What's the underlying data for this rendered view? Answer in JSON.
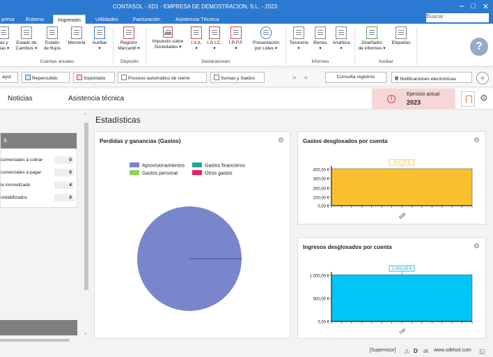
{
  "window": {
    "title": "CONTASOL - XD1 - EMPRESA DE DEMOSTRACION, S.L. - 2023",
    "search_label": "Buscar"
  },
  "menu": {
    "tabs": [
      {
        "label": "presa",
        "active": false
      },
      {
        "label": "Entorno",
        "active": false
      },
      {
        "label": "Impresión",
        "active": true
      },
      {
        "label": "Utilidades",
        "active": false
      },
      {
        "label": "Facturación",
        "active": false
      },
      {
        "label": "Asistencia Técnica",
        "active": false
      }
    ]
  },
  "ribbon": {
    "buttons": [
      {
        "label1": "ias y",
        "label2": "cias ▾",
        "icon": "document-icon"
      },
      {
        "label1": "Estado de",
        "label2": "Cambios ▾",
        "icon": "document-icon"
      },
      {
        "label1": "Estado",
        "label2": "de flujos",
        "icon": "document-icon"
      },
      {
        "label1": "Memoria",
        "label2": "",
        "icon": "document-icon"
      },
      {
        "label1": "Auxiliar",
        "label2": "▾",
        "icon": "list-icon"
      },
      {
        "label1": "Registro",
        "label2": "Mercantil ▾",
        "icon": "document-icon"
      },
      {
        "label1": "Impuesto sobre",
        "label2": "Sociedades ▾",
        "icon": "form-200-icon",
        "badge": "200"
      },
      {
        "label1": "I.V.A.",
        "label2": "▾",
        "icon": "form-icon"
      },
      {
        "label1": "I.G.I.C.",
        "label2": "▾",
        "icon": "form-icon"
      },
      {
        "label1": "I.R.P.F.",
        "label2": "▾",
        "icon": "form-icon"
      },
      {
        "label1": "Presentación",
        "label2": "por Lotes ▾",
        "icon": "cloud-upload-icon"
      },
      {
        "label1": "Tesorería",
        "label2": "▾",
        "icon": "document-icon"
      },
      {
        "label1": "Bienes",
        "label2": "▾",
        "icon": "document-icon"
      },
      {
        "label1": "Analítica",
        "label2": "▾",
        "icon": "document-icon"
      },
      {
        "label1": "Diseñador",
        "label2": "de informes ▾",
        "icon": "designer-icon"
      },
      {
        "label1": "Etiquetas",
        "label2": "",
        "icon": "labels-icon"
      }
    ],
    "groups": [
      {
        "label": "Cuentas anuales"
      },
      {
        "label": "Depósito"
      },
      {
        "label": "Declaraciones"
      },
      {
        "label": "Informes"
      },
      {
        "label": "Auxiliar"
      }
    ],
    "help_label": "?"
  },
  "toolbar": {
    "buttons": [
      {
        "label": "ayor",
        "icon": "none"
      },
      {
        "label": "Repercutido",
        "icon": "blue-doc-icon"
      },
      {
        "label": "Soportado",
        "icon": "red-doc-icon"
      },
      {
        "label": "Proceso automático de cierre",
        "icon": "close-process-icon"
      },
      {
        "label": "Sumas y Saldos",
        "icon": "sums-icon"
      },
      {
        "label": "Consulta registros",
        "icon": "none"
      },
      {
        "label": "Notificaciones electrónicas",
        "icon": "e-icon"
      }
    ],
    "arrows": "»  «",
    "plus": "+"
  },
  "header": {
    "noticias": "Noticias",
    "asistencia": "Asistencia técnica",
    "ejercicio_label": "Ejercicio actual",
    "ejercicio_year": "2023"
  },
  "left_panel": {
    "title": "s",
    "rows": [
      {
        "label": "comerciales a cobrar",
        "value": "0"
      },
      {
        "label": "comerciales a pagar",
        "value": "0"
      },
      {
        "label": "le inmovilizado",
        "value": "4"
      },
      {
        "label": "ontabilizados",
        "value": "0"
      }
    ]
  },
  "content": {
    "section_title": "Estadísticas"
  },
  "chart_data": [
    {
      "type": "pie",
      "title": "Perdidas y ganancias (Gastos)",
      "legend": [
        {
          "name": "Aprovisionamientos",
          "color": "#7986cb"
        },
        {
          "name": "Gastos financieros",
          "color": "#26a69a"
        },
        {
          "name": "Gastos personal",
          "color": "#8bd25a"
        },
        {
          "name": "Otros gastos",
          "color": "#e91e63"
        }
      ],
      "slices": [
        {
          "name": "Aprovisionamientos",
          "value": 100
        }
      ],
      "legend_position": "top"
    },
    {
      "type": "bar",
      "title": "Gastos desglosados por cuenta",
      "categories": [
        "600"
      ],
      "values": [
        413.22
      ],
      "data_label": "413,22 €",
      "yticks": [
        "0,00 €",
        "100,00 €",
        "200,00 €",
        "300,00 €",
        "400,00 €"
      ],
      "ylim": [
        0,
        413.22
      ],
      "color": "#fbc02d",
      "label_color": "#fbc02d",
      "grid": false
    },
    {
      "type": "bar",
      "title": "Ingresos desglosados por cuenta",
      "categories": [
        "700"
      ],
      "values": [
        1000
      ],
      "data_label": "1.000,00 €",
      "yticks": [
        "0,00 €",
        "500,00 €",
        "1.000,00 €"
      ],
      "ylim": [
        0,
        1000
      ],
      "color": "#00c6f5",
      "label_color": "#00aedc",
      "grid": false
    }
  ],
  "status": {
    "user": "[Supervisor]",
    "url": "www.sdelsol.com"
  }
}
